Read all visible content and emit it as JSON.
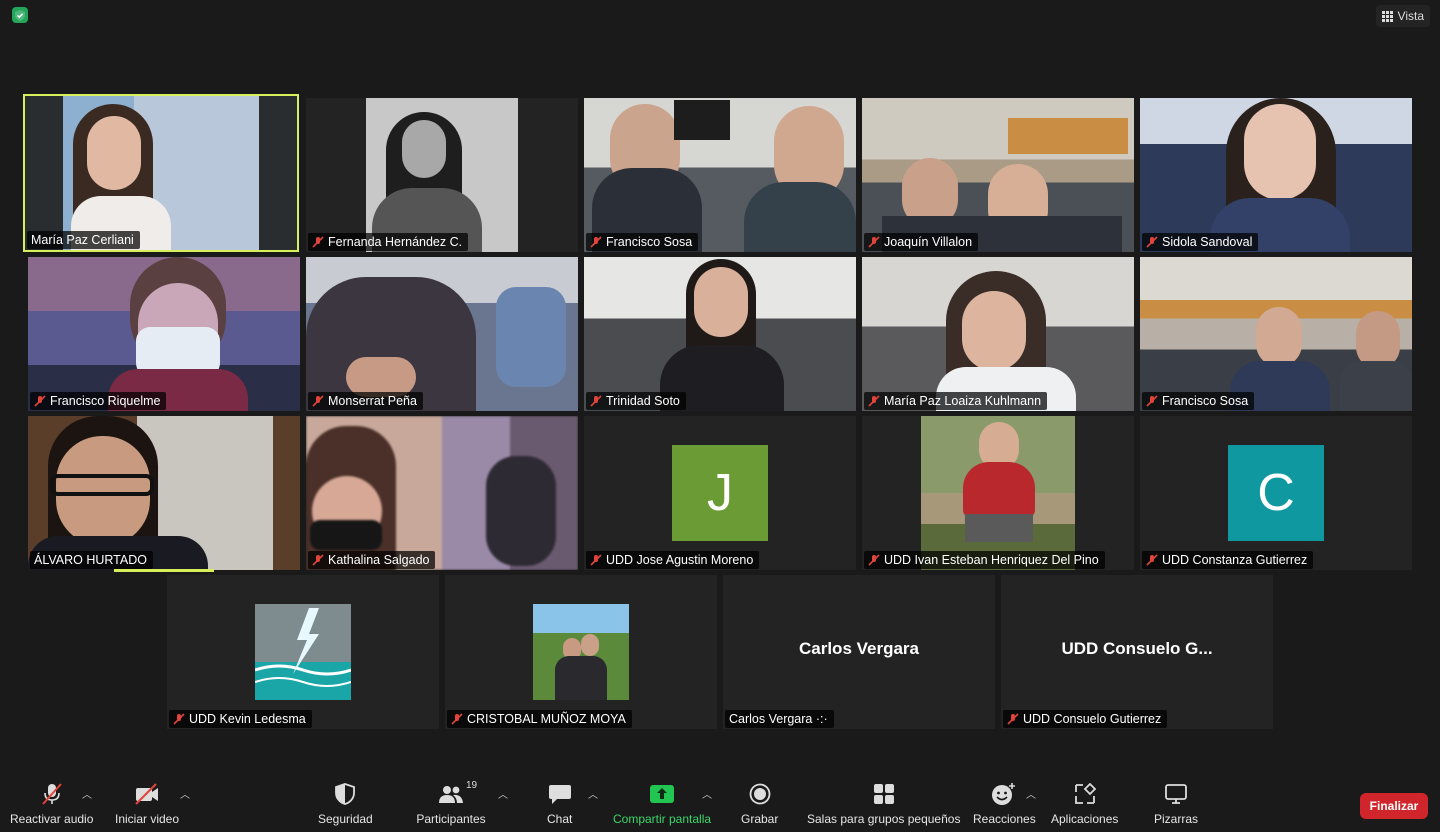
{
  "topbar": {
    "view_label": "Vista"
  },
  "tiles": [
    {
      "name": "María Paz Cerliani",
      "muted": false,
      "kind": "video",
      "bg": "#6a86a8"
    },
    {
      "name": "Fernanda Hernández C.",
      "muted": true,
      "kind": "video",
      "bg": "#8a8a8a"
    },
    {
      "name": "Francisco Sosa",
      "muted": true,
      "kind": "video",
      "bg": "#4a5158"
    },
    {
      "name": "Joaquín Villalon",
      "muted": true,
      "kind": "video",
      "bg": "#8f8a80"
    },
    {
      "name": "Sidola Sandoval",
      "muted": true,
      "kind": "video",
      "bg": "#3a4a6a"
    },
    {
      "name": "Francisco Riquelme",
      "muted": true,
      "kind": "video",
      "bg": "#6b6478"
    },
    {
      "name": "Monserrat Peña",
      "muted": true,
      "kind": "video",
      "bg": "#5e6b80"
    },
    {
      "name": "Trinidad Soto",
      "muted": true,
      "kind": "video",
      "bg": "#6e6e68"
    },
    {
      "name": "María Paz Loaiza Kuhlmann",
      "muted": true,
      "kind": "video",
      "bg": "#8d8c88"
    },
    {
      "name": "Francisco Sosa",
      "muted": true,
      "kind": "video",
      "bg": "#7a7470"
    },
    {
      "name": "ÁLVARO HURTADO",
      "muted": false,
      "kind": "video",
      "bg": "#7c6a58"
    },
    {
      "name": "Kathalina Salgado",
      "muted": true,
      "kind": "video",
      "bg": "#9a8a90"
    },
    {
      "name": "UDD Jose Agustin Moreno",
      "muted": true,
      "kind": "letter",
      "letter": "J",
      "color": "#6a9b35"
    },
    {
      "name": "UDD Ivan Esteban Henriquez Del Pino",
      "muted": true,
      "kind": "photo",
      "bg": "#6b7a4a"
    },
    {
      "name": "UDD Constanza Gutierrez",
      "muted": true,
      "kind": "letter",
      "letter": "C",
      "color": "#1098a0"
    },
    {
      "name": "UDD Kevin Ledesma",
      "muted": true,
      "kind": "storm"
    },
    {
      "name": "CRISTOBAL MUÑOZ MOYA",
      "muted": true,
      "kind": "photo2",
      "bg": "#6f9a55"
    },
    {
      "name": "Carlos Vergara ·:·",
      "muted": false,
      "kind": "text",
      "center": "Carlos Vergara"
    },
    {
      "name": "UDD Consuelo Gutierrez",
      "muted": true,
      "kind": "text",
      "center": "UDD Consuelo G..."
    }
  ],
  "toolbar": {
    "audio": "Reactivar audio",
    "video": "Iniciar video",
    "security": "Seguridad",
    "participants": "Participantes",
    "participants_count": "19",
    "chat": "Chat",
    "share": "Compartir pantalla",
    "record": "Grabar",
    "breakout": "Salas para grupos pequeños",
    "reactions": "Reacciones",
    "apps": "Aplicaciones",
    "whiteboards": "Pizarras",
    "end": "Finalizar"
  },
  "colors": {
    "active_speaker": "#d7f05a",
    "end": "#d0262b",
    "share": "#3bd66b"
  }
}
